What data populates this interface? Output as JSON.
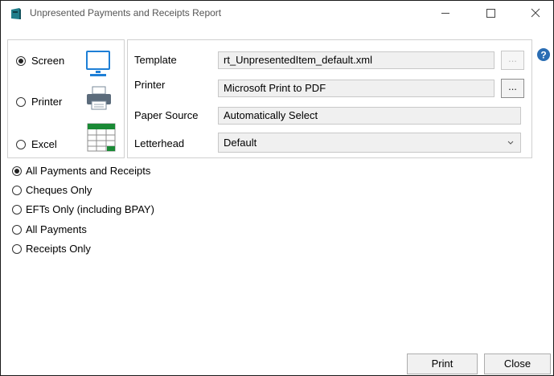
{
  "window": {
    "title": "Unpresented Payments and Receipts Report"
  },
  "output": {
    "options": [
      {
        "label": "Screen",
        "checked": true,
        "icon": "monitor-icon"
      },
      {
        "label": "Printer",
        "checked": false,
        "icon": "printer-icon"
      },
      {
        "label": "Excel",
        "checked": false,
        "icon": "spreadsheet-icon"
      }
    ]
  },
  "settings": {
    "template_label": "Template",
    "template_value": "rt_UnpresentedItem_default.xml",
    "printer_label": "Printer",
    "printer_value": "Microsoft Print to PDF",
    "paper_source_label": "Paper Source",
    "paper_source_value": "Automatically Select",
    "letterhead_label": "Letterhead",
    "letterhead_value": "Default",
    "ellipsis": "..."
  },
  "filter": {
    "options": [
      {
        "label": "All Payments and Receipts",
        "checked": true
      },
      {
        "label": "Cheques Only",
        "checked": false
      },
      {
        "label": "EFTs Only (including BPAY)",
        "checked": false
      },
      {
        "label": "All Payments",
        "checked": false
      },
      {
        "label": "Receipts Only",
        "checked": false
      }
    ]
  },
  "buttons": {
    "print": "Print",
    "close": "Close"
  },
  "colors": {
    "accent": "#1e7fd6",
    "excel_green": "#1a8a35",
    "help_blue": "#2a6db3",
    "app_icon_teal": "#1f7d8a"
  }
}
